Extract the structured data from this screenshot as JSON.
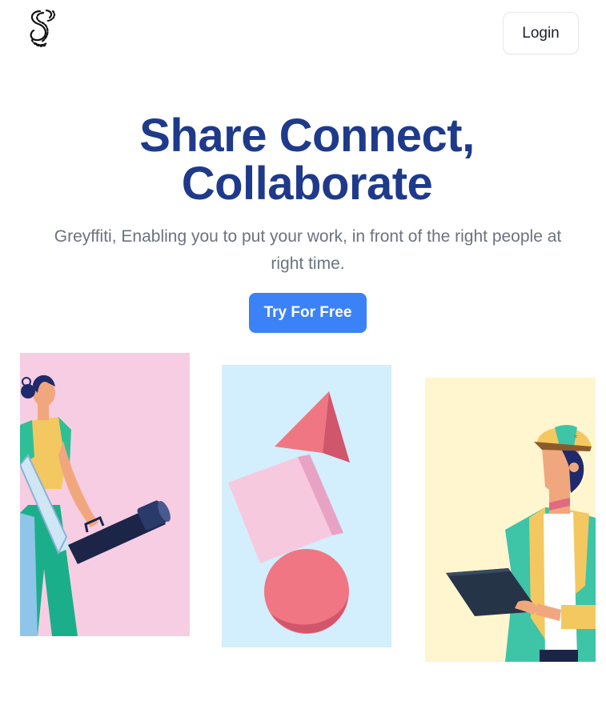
{
  "header": {
    "logo_icon": "greyffiti-logo-icon",
    "login_label": "Login"
  },
  "hero": {
    "title_line1": "Share Connect,",
    "title_line2": "Collaborate",
    "subtitle": "Greyffiti, Enabling you to put your work, in front of the right people at right time.",
    "cta_label": "Try For Free"
  },
  "illustrations": [
    {
      "name": "woman-with-telescope-illustration",
      "background": "#f7cde3"
    },
    {
      "name": "geometric-shapes-illustration",
      "background": "#d3eefc"
    },
    {
      "name": "engineer-with-clipboard-illustration",
      "background": "#fff6cf"
    }
  ],
  "colors": {
    "title": "#1f3a8a",
    "subtitle": "#6b7280",
    "primary": "#3b82f6"
  }
}
